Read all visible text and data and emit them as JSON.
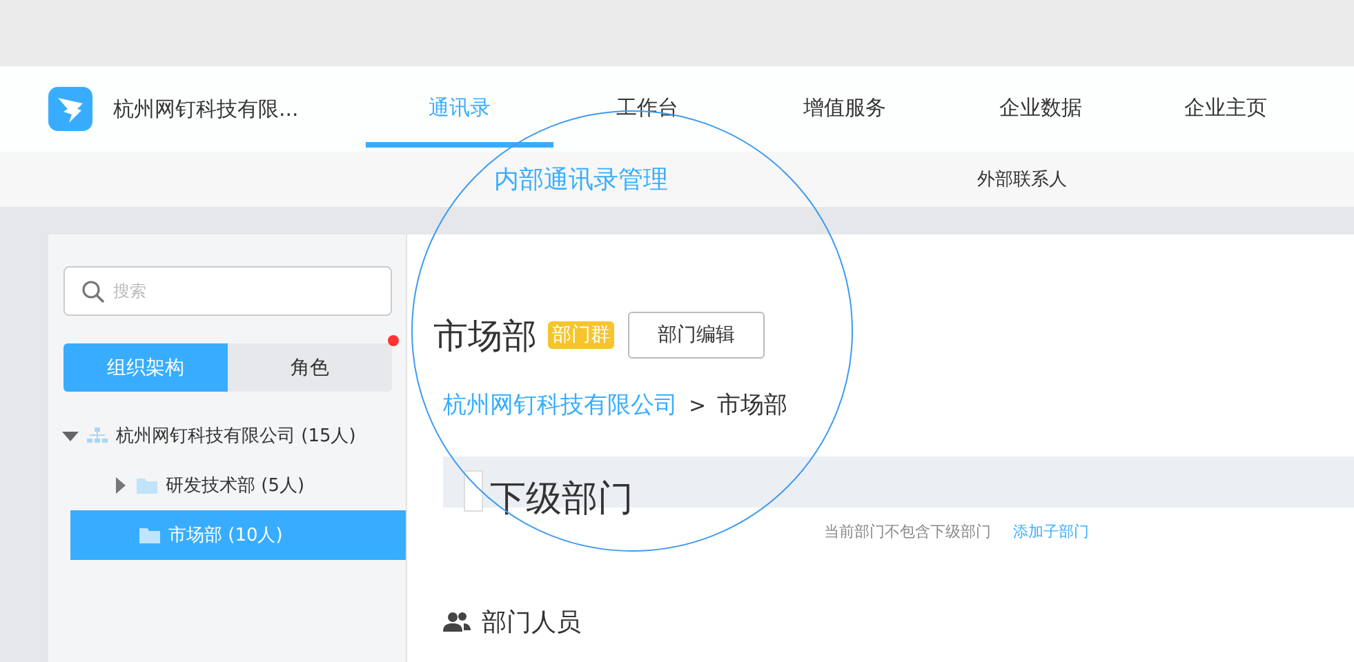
{
  "header": {
    "company": "杭州网钉科技有限...",
    "tabs": [
      {
        "label": "通讯录",
        "selected": true
      },
      {
        "label": "工作台",
        "selected": false
      },
      {
        "label": "增值服务",
        "selected": false
      },
      {
        "label": "企业数据",
        "selected": false
      },
      {
        "label": "企业主页",
        "selected": false
      }
    ]
  },
  "subnav": [
    {
      "label": "内部通讯录管理",
      "selected": true
    },
    {
      "label": "外部联系人",
      "selected": false
    }
  ],
  "sidebar": {
    "search": {
      "placeholder": "搜索"
    },
    "tabs": [
      {
        "label": "组织架构",
        "selected": true,
        "badge": false
      },
      {
        "label": "角色",
        "selected": false,
        "badge": true
      }
    ],
    "tree": [
      {
        "label": "杭州网钉科技有限公司 (15人)",
        "kind": "org",
        "expanded": true,
        "selected": false,
        "children": [
          {
            "label": "研发技术部 (5人)",
            "kind": "folder",
            "expanded": false,
            "has_children": true,
            "selected": false
          },
          {
            "label": "市场部 (10人)",
            "kind": "folder",
            "expanded": false,
            "has_children": false,
            "selected": true
          }
        ]
      }
    ]
  },
  "content": {
    "title": "市场部",
    "tag": "部门群",
    "edit_button": "部门编辑",
    "breadcrumb": [
      {
        "label": "杭州网钉科技有限公司",
        "kind": "link"
      },
      {
        "label": "市场部",
        "kind": "current"
      }
    ],
    "breadcrumb_separator": ">",
    "sub_departments": {
      "title": "下级部门",
      "empty_text": "当前部门不包含下级部门",
      "add_link": "添加子部门"
    },
    "members": {
      "title": "部门人员"
    }
  }
}
